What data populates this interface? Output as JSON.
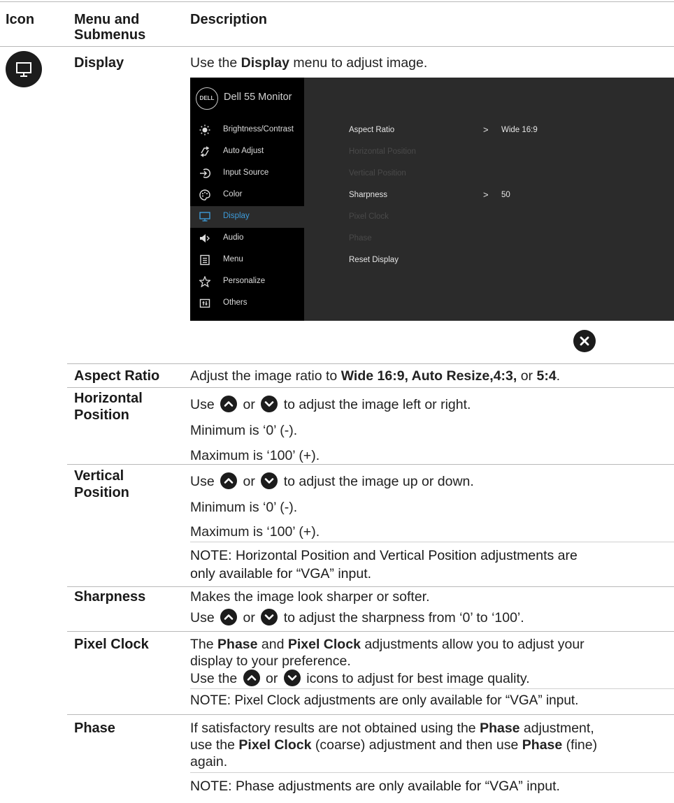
{
  "header": {
    "icon": "Icon",
    "menu_line1": "Menu and",
    "menu_line2": "Submenus",
    "description": "Description"
  },
  "display_section": {
    "icon": "monitor-icon",
    "name": "Display",
    "desc_pre": "Use the ",
    "desc_bold": "Display",
    "desc_post": " menu to adjust image."
  },
  "osd": {
    "logo": "DELL",
    "model": "Dell 55 Monitor",
    "menu_items": [
      {
        "label": "Brightness/Contrast",
        "icon": "brightness-icon"
      },
      {
        "label": "Auto Adjust",
        "icon": "auto-adjust-icon"
      },
      {
        "label": "Input Source",
        "icon": "input-source-icon"
      },
      {
        "label": "Color",
        "icon": "color-icon"
      },
      {
        "label": "Display",
        "icon": "monitor-icon"
      },
      {
        "label": "Audio",
        "icon": "speaker-icon"
      },
      {
        "label": "Menu",
        "icon": "menu-icon"
      },
      {
        "label": "Personalize",
        "icon": "star-icon"
      },
      {
        "label": "Others",
        "icon": "others-icon"
      }
    ],
    "settings": [
      {
        "label": "Aspect Ratio",
        "value": "Wide 16:9"
      },
      {
        "label": "Horizontal Position"
      },
      {
        "label": "Vertical Position"
      },
      {
        "label": "Sharpness",
        "value": "50"
      },
      {
        "label": "Pixel Clock"
      },
      {
        "label": "Phase"
      },
      {
        "label": "Reset Display"
      }
    ],
    "close_icon": "close-icon"
  },
  "rows": {
    "aspect": {
      "name": "Aspect Ratio",
      "pre": "Adjust the image ratio to ",
      "bold1": "Wide 16:9, Auto Resize,4:3,",
      "mid": " or ",
      "bold2": "5:4",
      "post": "."
    },
    "hpos": {
      "name_line1": "Horizontal",
      "name_line2": "Position",
      "use": "Use",
      "or": "or",
      "tail": "to adjust the image left or right.",
      "min": "Minimum is ‘0’ (-).",
      "max": "Maximum is ‘100’ (+)."
    },
    "vpos": {
      "name_line1": "Vertical",
      "name_line2": "Position",
      "use": "Use",
      "or": "or",
      "tail": "to adjust the image up or down.",
      "min": "Minimum is ‘0’ (-).",
      "max": "Maximum is ‘100’ (+).",
      "note_line1": "NOTE: Horizontal Position and Vertical Position adjustments are",
      "note_line2": "only available for “VGA” input."
    },
    "sharpness": {
      "name": "Sharpness",
      "line1": "Makes the image look sharper or softer.",
      "use": "Use",
      "or": "or",
      "tail": "to adjust the sharpness from ‘0’ to ‘100’."
    },
    "pixelclock": {
      "name": "Pixel Clock",
      "l1_pre": "The ",
      "l1_b1": "Phase",
      "l1_mid": " and ",
      "l1_b2": "Pixel Clock",
      "l1_post": " adjustments allow you to adjust your",
      "l2": "display to your preference.",
      "use": "Use the",
      "or": "or",
      "tail": "icons to adjust for best image quality.",
      "note": "NOTE: Pixel Clock adjustments are only available for “VGA” input."
    },
    "phase": {
      "name": "Phase",
      "l1_pre": "If satisfactory results are not obtained using the ",
      "l1_b": "Phase",
      "l1_post": " adjustment,",
      "l2_pre": "use the ",
      "l2_b1": "Pixel Clock",
      "l2_mid": " (coarse) adjustment and then use ",
      "l2_b2": "Phase",
      "l2_post": " (fine)",
      "l3": "again.",
      "note": "NOTE: Phase adjustments are only available for “VGA” input."
    }
  },
  "icons": {
    "up": "up-arrow-icon",
    "down": "down-arrow-icon"
  }
}
